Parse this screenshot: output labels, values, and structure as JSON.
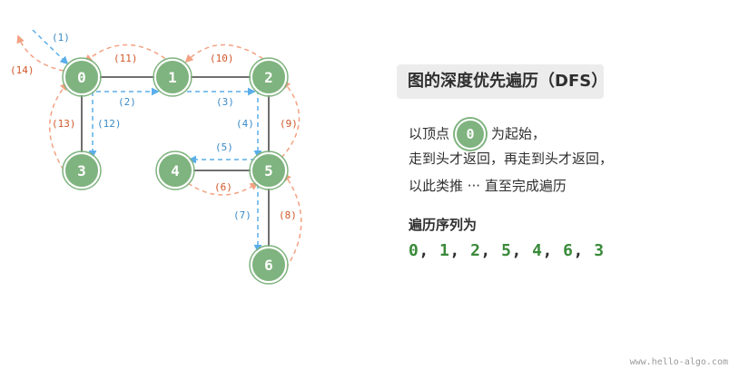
{
  "nodes": [
    {
      "id": "0",
      "label": "0"
    },
    {
      "id": "1",
      "label": "1"
    },
    {
      "id": "2",
      "label": "2"
    },
    {
      "id": "3",
      "label": "3"
    },
    {
      "id": "4",
      "label": "4"
    },
    {
      "id": "5",
      "label": "5"
    },
    {
      "id": "6",
      "label": "6"
    }
  ],
  "edges": [
    [
      "0",
      "1"
    ],
    [
      "1",
      "2"
    ],
    [
      "0",
      "3"
    ],
    [
      "2",
      "5"
    ],
    [
      "4",
      "5"
    ],
    [
      "5",
      "6"
    ]
  ],
  "steps": [
    {
      "label": "(1)",
      "kind": "forward"
    },
    {
      "label": "(2)",
      "kind": "forward"
    },
    {
      "label": "(3)",
      "kind": "forward"
    },
    {
      "label": "(4)",
      "kind": "forward"
    },
    {
      "label": "(5)",
      "kind": "forward"
    },
    {
      "label": "(6)",
      "kind": "backtrack"
    },
    {
      "label": "(7)",
      "kind": "forward"
    },
    {
      "label": "(8)",
      "kind": "backtrack"
    },
    {
      "label": "(9)",
      "kind": "backtrack"
    },
    {
      "label": "(10)",
      "kind": "backtrack"
    },
    {
      "label": "(11)",
      "kind": "backtrack"
    },
    {
      "label": "(12)",
      "kind": "forward"
    },
    {
      "label": "(13)",
      "kind": "backtrack"
    },
    {
      "label": "(14)",
      "kind": "backtrack"
    }
  ],
  "panel": {
    "title": "图的深度优先遍历（DFS）",
    "line1_pre": "以顶点",
    "line1_node": "0",
    "line1_post": "为起始，",
    "line2": "走到头才返回，再走到头才返回，",
    "line3": "以此类推 ··· 直至完成遍历",
    "seq_title": "遍历序列为",
    "sequence": [
      "0",
      "1",
      "2",
      "5",
      "4",
      "6",
      "3"
    ]
  },
  "footer": "www.hello-algo.com",
  "colors": {
    "node_fill": "#7fb37f",
    "edge": "#6f6f6f",
    "forward": "#5aaeea",
    "backtrack": "#f2a283",
    "forward_text": "#3b8ac6",
    "backtrack_text": "#d0582a"
  }
}
